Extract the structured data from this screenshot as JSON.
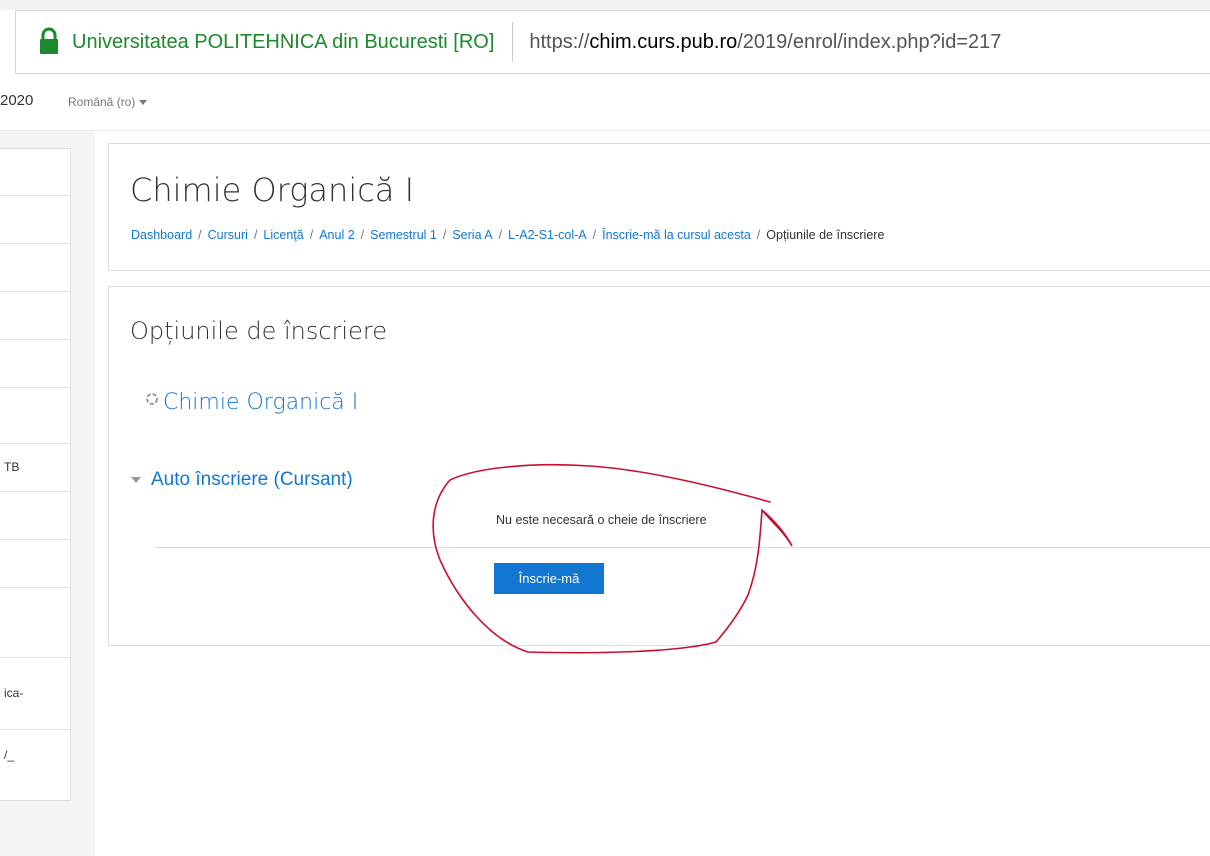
{
  "browser": {
    "site_identity": "Universitatea POLITEHNICA din Bucuresti [RO]",
    "url_prefix": "https://",
    "url_host": "chim.curs.pub.ro",
    "url_path": "/2019/enrol/index.php?id=217"
  },
  "topnav": {
    "year_fragment": "2020",
    "language": "Română (ro)"
  },
  "drawer": {
    "fragments": [
      "TB",
      "ica-",
      "/_"
    ]
  },
  "header": {
    "course_title": "Chimie Organică I",
    "breadcrumb": [
      "Dashboard",
      "Cursuri",
      "Licenţă",
      "Anul 2",
      "Semestrul 1",
      "Seria A",
      "L-A2-S1-col-A",
      "Înscrie-mă la cursul acesta",
      "Opțiunile de înscriere"
    ]
  },
  "main": {
    "heading": "Opțiunile de înscriere",
    "course_link": "Chimie Organică I",
    "enrol_method": "Auto înscriere (Cursant)",
    "no_key_text": "Nu este necesară o cheie de înscriere",
    "enrol_button": "Înscrie-mă"
  },
  "colors": {
    "link": "#1177d1",
    "button": "#1177d1",
    "secure_green": "#1a8a2c",
    "annotation": "#c8102e"
  }
}
